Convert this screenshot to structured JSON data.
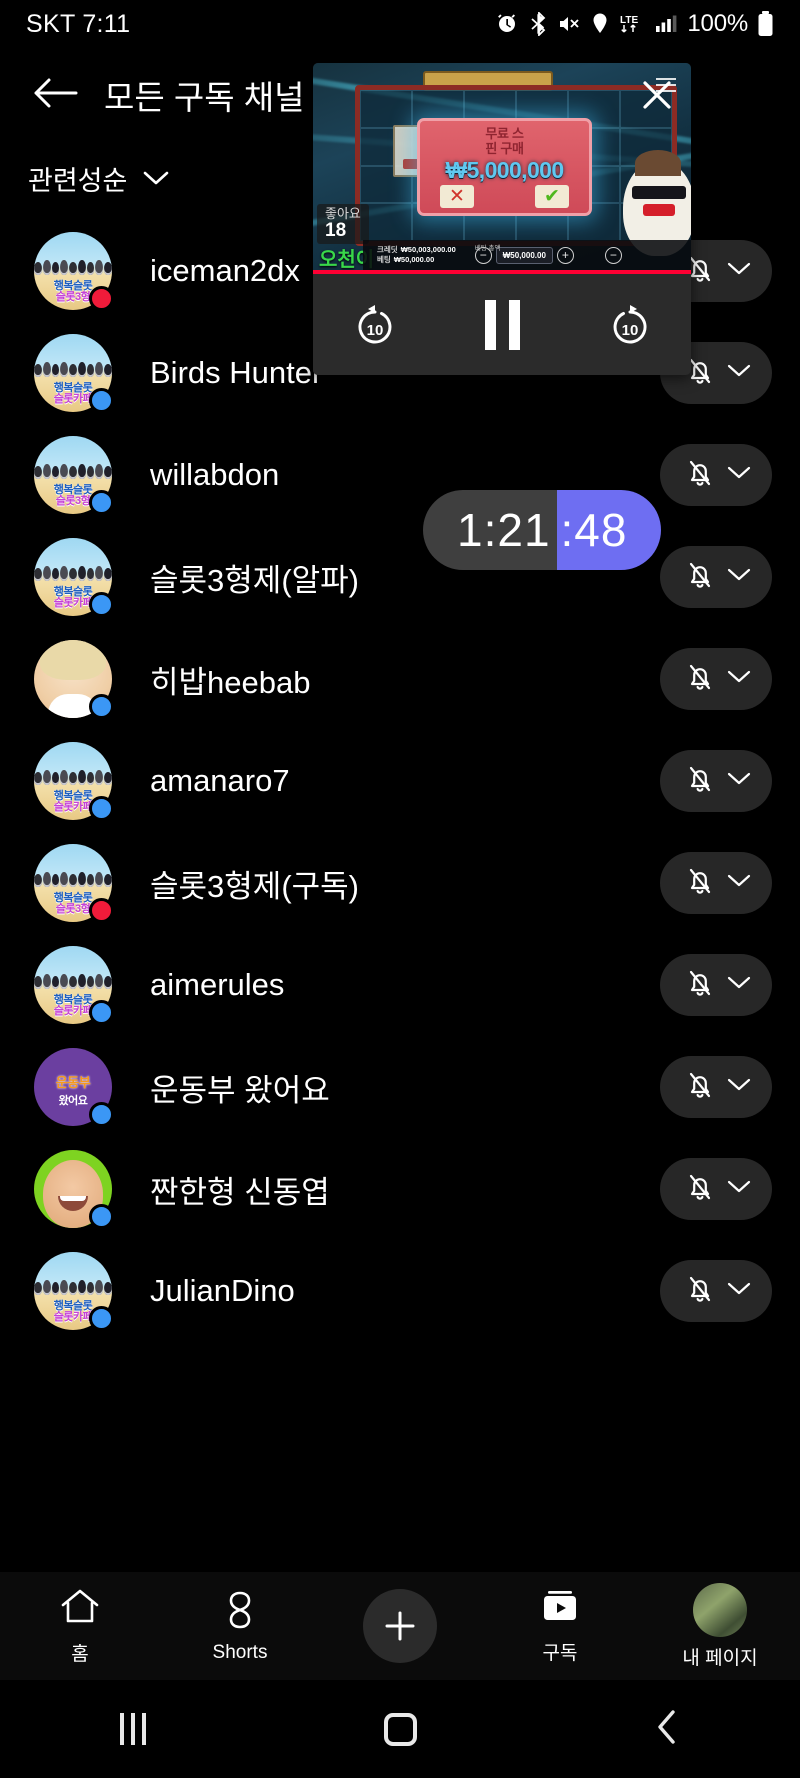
{
  "status_bar": {
    "carrier_time": "SKT 7:11",
    "battery_percent": "100%",
    "icons": [
      "alarm-icon",
      "bluetooth-icon",
      "mute-icon",
      "location-icon",
      "lte-icon",
      "signal-icon",
      "battery-icon"
    ]
  },
  "header": {
    "back_icon": "arrow-left-icon",
    "title": "모든 구독 채널"
  },
  "sort": {
    "label": "관련성순",
    "chevron_icon": "chevron-down-icon"
  },
  "channels": [
    {
      "name": "iceman2dx",
      "avatar": "slot",
      "avatar_line1": "행복슬롯",
      "avatar_line2": "슬롯3형",
      "dot": "red",
      "bell_icon": "bell-off-icon",
      "chevron_icon": "chevron-down-icon"
    },
    {
      "name": "Birds Hunter",
      "avatar": "slot",
      "avatar_line1": "행복슬롯",
      "avatar_line2": "슬롯카페",
      "dot": "blue",
      "bell_icon": "bell-off-icon",
      "chevron_icon": "chevron-down-icon"
    },
    {
      "name": "willabdon",
      "avatar": "slot",
      "avatar_line1": "행복슬롯",
      "avatar_line2": "슬롯3형",
      "dot": "blue",
      "bell_icon": "bell-off-icon",
      "chevron_icon": "chevron-down-icon"
    },
    {
      "name": "슬롯3형제(알파)",
      "avatar": "slot",
      "avatar_line1": "행복슬롯",
      "avatar_line2": "슬롯카페",
      "dot": "blue",
      "bell_icon": "bell-off-icon",
      "chevron_icon": "chevron-down-icon"
    },
    {
      "name": "히밥heebab",
      "avatar": "face",
      "avatar_line1": "",
      "avatar_line2": "",
      "dot": "blue",
      "bell_icon": "bell-off-icon",
      "chevron_icon": "chevron-down-icon"
    },
    {
      "name": "amanaro7",
      "avatar": "slot",
      "avatar_line1": "행복슬롯",
      "avatar_line2": "슬롯카페",
      "dot": "blue",
      "bell_icon": "bell-off-icon",
      "chevron_icon": "chevron-down-icon"
    },
    {
      "name": "슬롯3형제(구독)",
      "avatar": "slot",
      "avatar_line1": "행복슬롯",
      "avatar_line2": "슬롯3형",
      "dot": "red",
      "bell_icon": "bell-off-icon",
      "chevron_icon": "chevron-down-icon"
    },
    {
      "name": "aimerules",
      "avatar": "slot",
      "avatar_line1": "행복슬롯",
      "avatar_line2": "슬롯카페",
      "dot": "blue",
      "bell_icon": "bell-off-icon",
      "chevron_icon": "chevron-down-icon"
    },
    {
      "name": "운동부 왔어요",
      "avatar": "purple",
      "avatar_line1": "운동부",
      "avatar_line2": "왔어요",
      "dot": "blue",
      "bell_icon": "bell-off-icon",
      "chevron_icon": "chevron-down-icon"
    },
    {
      "name": "짠한형 신동엽",
      "avatar": "green",
      "avatar_line1": "",
      "avatar_line2": "",
      "dot": "blue",
      "bell_icon": "bell-off-icon",
      "chevron_icon": "chevron-down-icon"
    },
    {
      "name": "JulianDino",
      "avatar": "slot",
      "avatar_line1": "행복슬롯",
      "avatar_line2": "슬롯카페",
      "dot": "blue",
      "bell_icon": "bell-off-icon",
      "chevron_icon": "chevron-down-icon"
    }
  ],
  "pip_player": {
    "close_icon": "close-icon",
    "menu_icon": "hamburger-menu-icon",
    "rewind_label": "10",
    "forward_label": "10",
    "pause_icon": "pause-icon",
    "like_label": "좋아요",
    "like_count": "18",
    "streamer_name": "오천이",
    "game": {
      "offer_line1": "무료 스",
      "offer_line2": "핀 구매",
      "offer_amount": "₩5,000,000",
      "decline_icon": "cross-icon",
      "accept_icon": "check-icon",
      "credit_label_1": "크레딧",
      "credit_value_1": "₩50,003,000.00",
      "credit_label_2": "베팅",
      "credit_value_2": "₩50,000.00",
      "bet_title": "베팅 총액",
      "bet_value": "₩50,000.00",
      "minus_icon": "minus-circle-icon",
      "plus_icon": "plus-circle-icon"
    }
  },
  "seek_timer": {
    "elapsed": "1:21",
    "remaining": ":48",
    "accent_color": "#6e6ef2"
  },
  "tab_bar": {
    "tabs": [
      {
        "label": "홈",
        "icon": "home-icon"
      },
      {
        "label": "Shorts",
        "icon": "shorts-icon"
      },
      {
        "label": "",
        "icon": "plus-icon"
      },
      {
        "label": "구독",
        "icon": "subscriptions-icon"
      },
      {
        "label": "내 페이지",
        "icon": "account-avatar-icon"
      }
    ]
  },
  "android_nav": {
    "recents_icon": "recents-icon",
    "home_icon": "home-square-icon",
    "back_icon": "back-chevron-icon"
  }
}
